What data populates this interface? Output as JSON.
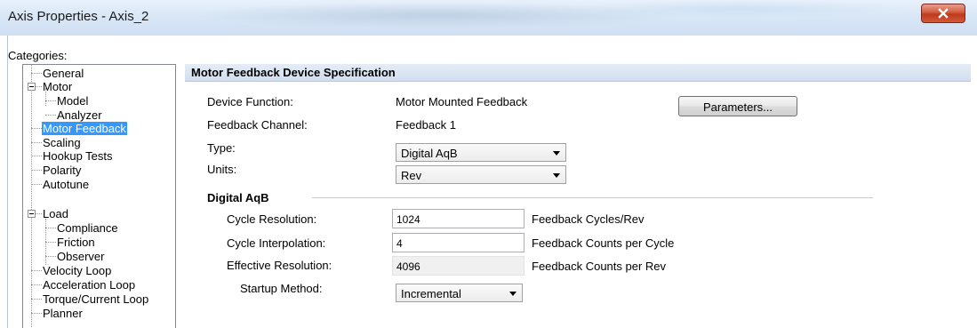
{
  "window": {
    "title": "Axis Properties - Axis_2",
    "close_icon": "close-x-icon"
  },
  "categories": {
    "label": "Categories:",
    "items": [
      {
        "label": "General"
      },
      {
        "label": "Motor"
      },
      {
        "label": "Model"
      },
      {
        "label": "Analyzer"
      },
      {
        "label": "Motor Feedback",
        "selected": true
      },
      {
        "label": "Scaling"
      },
      {
        "label": "Hookup Tests"
      },
      {
        "label": "Polarity"
      },
      {
        "label": "Autotune"
      },
      {
        "label": "Load"
      },
      {
        "label": "Compliance"
      },
      {
        "label": "Friction"
      },
      {
        "label": "Observer"
      },
      {
        "label": "Velocity Loop"
      },
      {
        "label": "Acceleration Loop"
      },
      {
        "label": "Torque/Current Loop"
      },
      {
        "label": "Planner"
      }
    ]
  },
  "section": {
    "title": "Motor Feedback Device Specification"
  },
  "device_function": {
    "label": "Device Function:",
    "value": "Motor Mounted Feedback"
  },
  "feedback_channel": {
    "label": "Feedback Channel:",
    "value": "Feedback 1"
  },
  "parameters_button": "Parameters...",
  "type": {
    "label": "Type:",
    "value": "Digital AqB"
  },
  "units": {
    "label": "Units:",
    "value": "Rev"
  },
  "group": {
    "title": "Digital AqB",
    "cycle_resolution": {
      "label": "Cycle Resolution:",
      "value": "1024",
      "unit": "Feedback Cycles/Rev"
    },
    "cycle_interpolation": {
      "label": "Cycle Interpolation:",
      "value": "4",
      "unit": "Feedback Counts per Cycle"
    },
    "effective_resolution": {
      "label": "Effective Resolution:",
      "value": "4096",
      "unit": "Feedback Counts per Rev"
    },
    "startup_method": {
      "label": "Startup Method:",
      "value": "Incremental"
    }
  },
  "colors": {
    "selection": "#3399ff",
    "header": "#d2def0",
    "close": "#c0391c"
  }
}
